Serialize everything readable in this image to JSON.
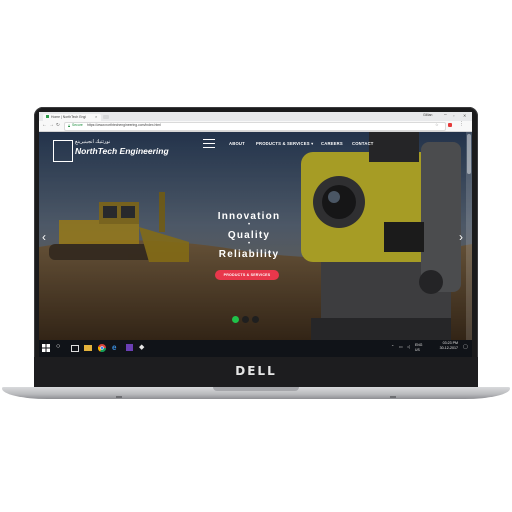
{
  "browser": {
    "tab_title": "Home | NorthTech Engi",
    "user": "Gillian",
    "window_controls": [
      "minimize",
      "maximize",
      "close"
    ],
    "secure_label": "Secure",
    "url": "https://www.northtechengineering.com/index.html",
    "extension_icons": [
      "star-icon",
      "adblock-icon",
      "menu-icon"
    ]
  },
  "site": {
    "brand_arabic": "نورثتيك انجينيرينغ",
    "brand_name": "NorthTech Engineering",
    "nav": [
      "ABOUT",
      "PRODUCTS & SERVICES",
      "CAREERS",
      "CONTACT"
    ],
    "hero_lines": [
      "Innovation",
      "Quality",
      "Reliability"
    ],
    "hero_separator": "•",
    "cta_label": "PRODUCTS & SERVICES",
    "slides": 3,
    "active_slide": 1
  },
  "taskbar": {
    "apps": [
      "windows-start-icon",
      "search-icon",
      "task-view-icon",
      "file-explorer-icon",
      "chrome-icon",
      "edge-icon",
      "visual-studio-icon",
      "git-icon"
    ],
    "language": "ENG",
    "region": "US",
    "time": "03:23 PM",
    "date": "30-12-2017"
  },
  "device": {
    "brand": "DELL"
  }
}
